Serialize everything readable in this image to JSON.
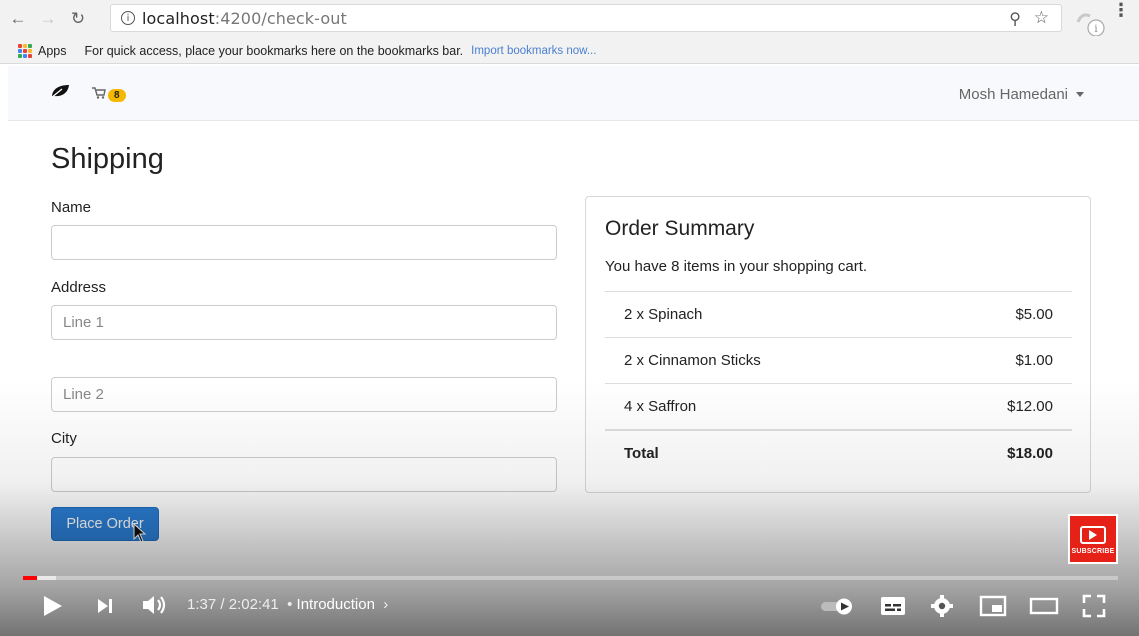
{
  "browser": {
    "url_host": "localhost",
    "url_path": ":4200/check-out",
    "bookmarks": {
      "apps_label": "Apps",
      "note": "For quick access, place your bookmarks here on the bookmarks bar.",
      "import_link": "Import bookmarks now..."
    }
  },
  "navbar": {
    "cart_count": "8",
    "user_name": "Mosh Hamedani"
  },
  "shipping": {
    "title": "Shipping",
    "name_label": "Name",
    "name_value": "",
    "address_label": "Address",
    "line1_placeholder": "Line 1",
    "line2_placeholder": "Line 2",
    "city_label": "City",
    "city_value": "",
    "submit_label": "Place Order"
  },
  "summary": {
    "title": "Order Summary",
    "text": "You have 8 items in your shopping cart.",
    "items": [
      {
        "label": "2 x Spinach",
        "price": "$5.00"
      },
      {
        "label": "2 x Cinnamon Sticks",
        "price": "$1.00"
      },
      {
        "label": "4 x Saffron",
        "price": "$12.00"
      }
    ],
    "total_label": "Total",
    "total_value": "$18.00"
  },
  "player": {
    "current_time": "1:37",
    "duration": "2:02:41",
    "separator": " / ",
    "chapter": "Introduction",
    "subscribe_label": "SUBSCRIBE",
    "progress_played": 0.013,
    "progress_buffered": 0.03
  }
}
